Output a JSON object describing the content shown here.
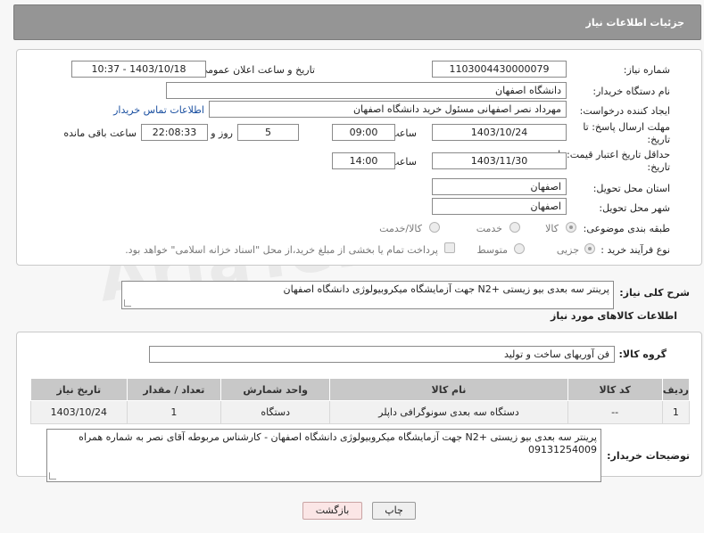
{
  "header": {
    "title": "جزئیات اطلاعات نیاز"
  },
  "fields": {
    "need_number_label": "شماره نیاز:",
    "need_number": "1103004430000079",
    "announce_datetime_label": "تاریخ و ساعت اعلان عمومی:",
    "announce_datetime": "1403/10/18 - 10:37",
    "buyer_org_label": "نام دستگاه خریدار:",
    "buyer_org": "دانشگاه اصفهان",
    "requester_label": "ایجاد کننده درخواست:",
    "requester": "مهرداد نصر اصفهانی مسئول خرید دانشگاه اصفهان",
    "contact_link": "اطلاعات تماس خریدار",
    "reply_deadline_label": "مهلت ارسال پاسخ: تا تاریخ:",
    "reply_deadline_date": "1403/10/24",
    "time_label": "ساعت",
    "reply_deadline_time": "09:00",
    "days_value": "5",
    "days_label": "روز و",
    "remaining_time": "22:08:33",
    "remaining_label": "ساعت باقی مانده",
    "price_validity_label": "حداقل تاریخ اعتبار قیمت: تا تاریخ:",
    "price_validity_date": "1403/11/30",
    "price_validity_time": "14:00",
    "province_label": "استان محل تحویل:",
    "province": "اصفهان",
    "city_label": "شهر محل تحویل:",
    "city": "اصفهان",
    "category_label": "طبقه بندی موضوعی:",
    "category_options": [
      "کالا",
      "خدمت",
      "کالا/خدمت"
    ],
    "process_label": "نوع فرآیند خرید :",
    "process_options": [
      "جزیی",
      "متوسط"
    ],
    "payment_note": "پرداخت تمام یا بخشی از مبلغ خرید،از محل \"اسناد خزانه اسلامی\" خواهد بود.",
    "summary_label": "شرح کلی نیاز:",
    "summary": "پرینتر سه بعدی بیو زیستی +N2 جهت آزمایشگاه میکروبیولوژی دانشگاه اصفهان",
    "goods_info_title": "اطلاعات کالاهای مورد نیاز",
    "goods_group_label": "گروه کالا:",
    "goods_group": "فن آوریهای ساخت و تولید"
  },
  "table": {
    "headers": [
      "ردیف",
      "کد کالا",
      "نام کالا",
      "واحد شمارش",
      "تعداد / مقدار",
      "تاریخ نیاز"
    ],
    "rows": [
      [
        "1",
        "--",
        "دستگاه سه بعدی سونوگرافی داپلر",
        "دستگاه",
        "1",
        "1403/10/24"
      ]
    ]
  },
  "buyer_notes_label": "توضیحات خریدار:",
  "buyer_notes": "پرینتر سه بعدی بیو زیستی +N2 جهت آزمایشگاه میکروبیولوژی دانشگاه اصفهان - کارشناس مربوطه آقای نصر به شماره همراه 09131254009",
  "buttons": {
    "print": "چاپ",
    "back": "بازگشت"
  },
  "watermark": "AriaTender.net"
}
